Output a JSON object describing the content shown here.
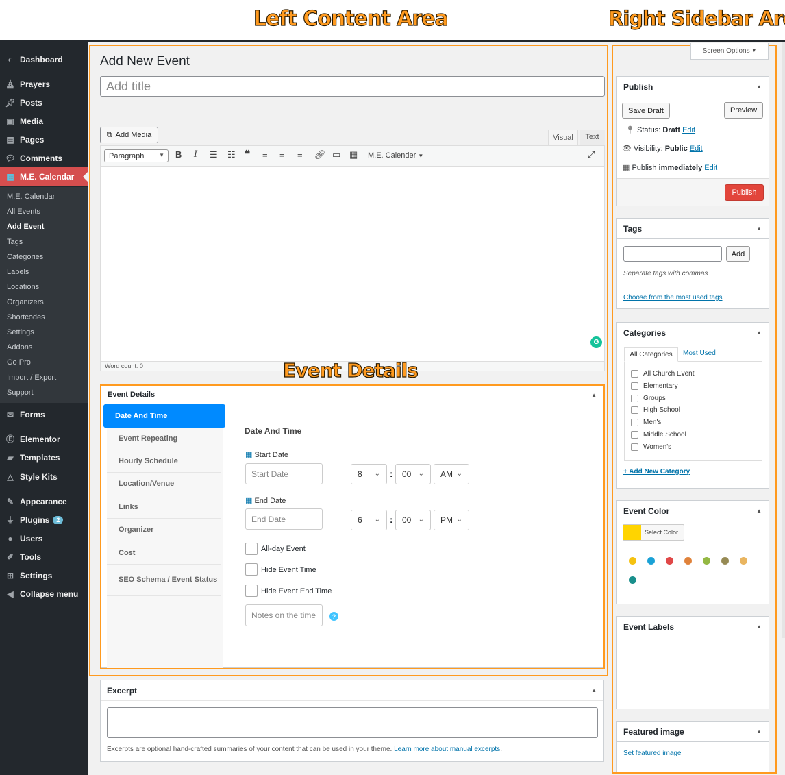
{
  "annotations": {
    "left": "Left Content Area",
    "right": "Right Sidebar Area",
    "event_details": "Event Details"
  },
  "sidebar": {
    "items": [
      {
        "label": "Dashboard",
        "icon": "dashboard-icon"
      },
      {
        "label": "Prayers",
        "icon": "prayer-icon"
      },
      {
        "label": "Posts",
        "icon": "pin-icon"
      },
      {
        "label": "Media",
        "icon": "media-icon"
      },
      {
        "label": "Pages",
        "icon": "pages-icon"
      },
      {
        "label": "Comments",
        "icon": "comment-icon"
      },
      {
        "label": "M.E. Calendar",
        "icon": "calendar-icon"
      },
      {
        "label": "Forms",
        "icon": "mail-icon"
      },
      {
        "label": "Elementor",
        "icon": "elementor-icon"
      },
      {
        "label": "Templates",
        "icon": "folder-icon"
      },
      {
        "label": "Style Kits",
        "icon": "triangle-icon"
      },
      {
        "label": "Appearance",
        "icon": "brush-icon"
      },
      {
        "label": "Plugins",
        "icon": "plug-icon",
        "badge": "2"
      },
      {
        "label": "Users",
        "icon": "user-icon"
      },
      {
        "label": "Tools",
        "icon": "wrench-icon"
      },
      {
        "label": "Settings",
        "icon": "settings-icon"
      },
      {
        "label": "Collapse menu",
        "icon": "collapse-icon"
      }
    ],
    "submenu": [
      "M.E. Calendar",
      "All Events",
      "Add Event",
      "Tags",
      "Categories",
      "Labels",
      "Locations",
      "Organizers",
      "Shortcodes",
      "Settings",
      "Addons",
      "Go Pro",
      "Import / Export",
      "Support"
    ]
  },
  "editor": {
    "page_title": "Add New Event",
    "title_placeholder": "Add title",
    "add_media": "Add Media",
    "tab_visual": "Visual",
    "tab_text": "Text",
    "format_select": "Paragraph",
    "calendar_menu": "M.E. Calender",
    "word_count": "Word count: 0"
  },
  "event_details": {
    "title": "Event Details",
    "tabs": [
      "Date And Time",
      "Event Repeating",
      "Hourly Schedule",
      "Location/Venue",
      "Links",
      "Organizer",
      "Cost",
      "SEO Schema / Event Status"
    ],
    "section_title": "Date And Time",
    "start_label": "Start Date",
    "start_placeholder": "Start Date",
    "start_hour": "8",
    "start_minute": "00",
    "start_ampm": "AM",
    "end_label": "End Date",
    "end_placeholder": "End Date",
    "end_hour": "6",
    "end_minute": "00",
    "end_ampm": "PM",
    "colon": ":",
    "allday": "All-day Event",
    "hide_time": "Hide Event Time",
    "hide_end": "Hide Event End Time",
    "notes_placeholder": "Notes on the time",
    "help": "?"
  },
  "excerpt": {
    "title": "Excerpt",
    "help_text": "Excerpts are optional hand-crafted summaries of your content that can be used in your theme.",
    "help_link": "Learn more about manual excerpts",
    "period": "."
  },
  "screen_options": "Screen Options",
  "publish": {
    "title": "Publish",
    "save_draft": "Save Draft",
    "preview": "Preview",
    "status_label": "Status:",
    "status_value": "Draft",
    "visibility_label": "Visibility:",
    "visibility_value": "Public",
    "publish_label": "Publish",
    "publish_value": "immediately",
    "edit": "Edit",
    "publish_button": "Publish"
  },
  "tags": {
    "title": "Tags",
    "add": "Add",
    "hint": "Separate tags with commas",
    "choose": "Choose from the most used tags"
  },
  "categories": {
    "title": "Categories",
    "tab_all": "All Categories",
    "tab_used": "Most Used",
    "items": [
      "All Church Event",
      "Elementary",
      "Groups",
      "High School",
      "Men's",
      "Middle School",
      "Women's"
    ],
    "add_new": "+ Add New Category"
  },
  "event_color": {
    "title": "Event Color",
    "select": "Select Color",
    "current": "#ffd400",
    "palette": [
      "#f5c211",
      "#1aa1d6",
      "#e04848",
      "#e0823a",
      "#94b843",
      "#968a54",
      "#e9b560",
      "#198f8c"
    ]
  },
  "event_labels": {
    "title": "Event Labels"
  },
  "featured_image": {
    "title": "Featured image",
    "set": "Set featured image"
  }
}
